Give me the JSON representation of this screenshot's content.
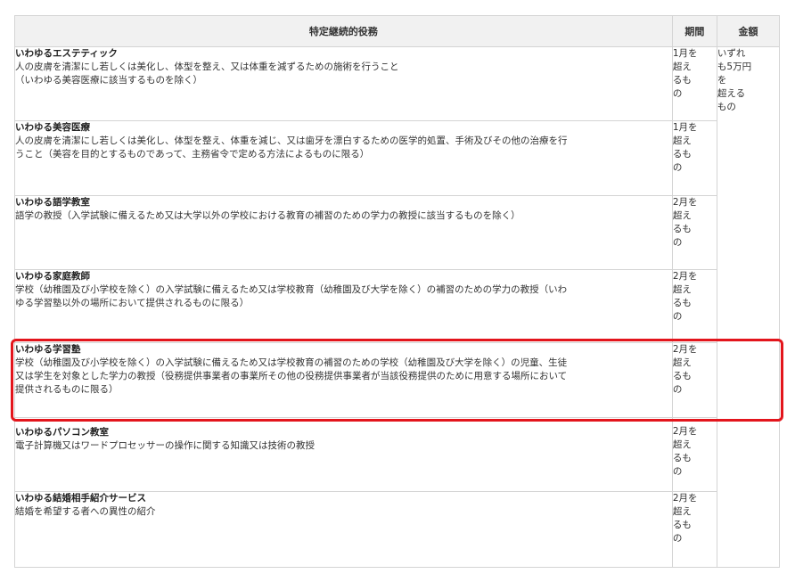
{
  "table": {
    "headers": {
      "service": "特定継続的役務",
      "period": "期間",
      "amount": "金額"
    },
    "amount_text": "いずれ\nも5万円\nを\n超える\nもの",
    "rows": [
      {
        "name": "いわゆるエステティック",
        "description": "人の皮膚を清潔にし若しくは美化し、体型を整え、又は体重を減ずるための施術を行うこと\n（いわゆる美容医療に該当するものを除く）",
        "period": "1月を\n超え\nるも\nの"
      },
      {
        "name": "いわゆる美容医療",
        "description": "人の皮膚を清潔にし若しくは美化し、体型を整え、体重を減じ、又は歯牙を漂白するための医学的処置、手術及びその他の治療を行\nうこと（美容を目的とするものであって、主務省令で定める方法によるものに限る）",
        "period": "1月を\n超え\nるも\nの"
      },
      {
        "name": "いわゆる語学教室",
        "description": "語学の教授（入学試験に備えるため又は大学以外の学校における教育の補習のための学力の教授に該当するものを除く）",
        "period": "2月を\n超え\nるも\nの"
      },
      {
        "name": "いわゆる家庭教師",
        "description": "学校（幼稚園及び小学校を除く）の入学試験に備えるため又は学校教育（幼稚園及び大学を除く）の補習のための学力の教授（いわ\nゆる学習塾以外の場所において提供されるものに限る）",
        "period": "2月を\n超え\nるも\nの"
      },
      {
        "name": "いわゆる学習塾",
        "description": "学校（幼稚園及び小学校を除く）の入学試験に備えるため又は学校教育の補習のための学校（幼稚園及び大学を除く）の児童、生徒\n又は学生を対象とした学力の教授（役務提供事業者の事業所その他の役務提供事業者が当該役務提供のために用意する場所において\n提供されるものに限る）",
        "period": "2月を\n超え\nるも\nの"
      },
      {
        "name": "いわゆるパソコン教室",
        "description": "電子計算機又はワードプロセッサーの操作に関する知識又は技術の教授",
        "period": "2月を\n超え\nるも\nの"
      },
      {
        "name": "いわゆる結婚相手紹介サービス",
        "description": "結婚を希望する者への異性の紹介",
        "period": "2月を\n超え\nるも\nの"
      }
    ]
  },
  "highlight": {
    "color": "#e3151c",
    "row": "いわゆる学習塾"
  }
}
